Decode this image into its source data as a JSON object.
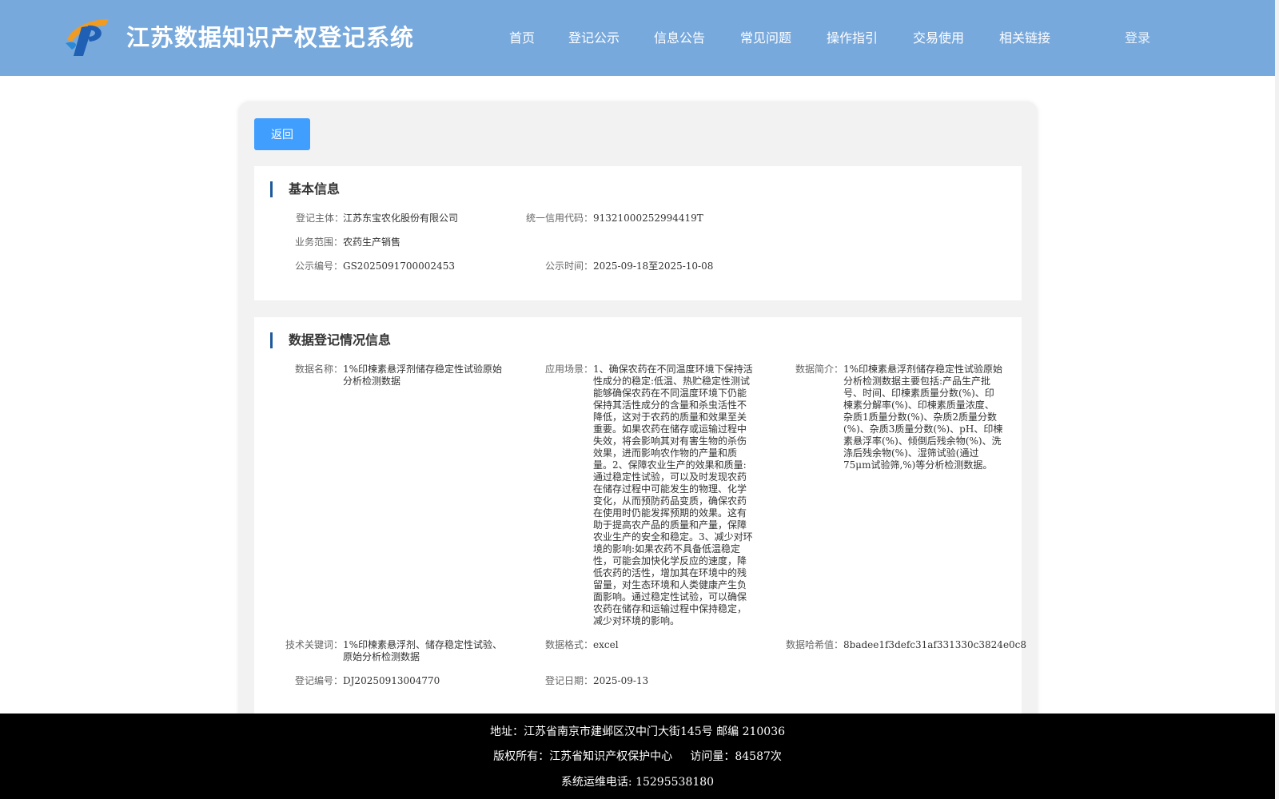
{
  "header": {
    "title": "江苏数据知识产权登记系统",
    "nav": [
      "首页",
      "登记公示",
      "信息公告",
      "常见问题",
      "操作指引",
      "交易使用",
      "相关链接"
    ],
    "login": "登录"
  },
  "back_label": "返回",
  "basic": {
    "title": "基本信息",
    "subject_label": "登记主体：",
    "subject_value": "江苏东宝农化股份有限公司",
    "credit_label": "统一信用代码：",
    "credit_value": "91321000252994419T",
    "scope_label": "业务范围：",
    "scope_value": "农药生产销售",
    "pub_no_label": "公示编号：",
    "pub_no_value": "GS2025091700002453",
    "pub_time_label": "公示时间：",
    "pub_time_value": "2025-09-18至2025-10-08"
  },
  "registration": {
    "title": "数据登记情况信息",
    "name_label": "数据名称：",
    "name_value": "1%印楝素悬浮剂储存稳定性试验原始分析检测数据",
    "scene_label": "应用场景：",
    "scene_value": "1、确保农药在不同温度环境下保持活性成分的稳定:低温、热贮稳定性测试能够确保农药在不同温度环境下仍能保持其活性成分的含量和杀虫活性不降低，这对于农药的质量和效果至关重要。如果农药在储存或运输过程中失效，将会影响其对有害生物的杀伤效果，进而影响农作物的产量和质量。2、保障农业生产的效果和质量:通过稳定性试验，可以及时发现农药在储存过程中可能发生的物理、化学变化，从而预防药品变质，确保农药在使用时仍能发挥预期的效果。这有助于提高农产品的质量和产量，保障农业生产的安全和稳定。3、减少对环境的影响:如果农药不具备低温稳定性，可能会加快化学反应的速度，降低农药的活性，增加其在环境中的残留量，对生态环境和人类健康产生负面影响。通过稳定性试验，可以确保农药在储存和运输过程中保持稳定，减少对环境的影响。",
    "summary_label": "数据简介：",
    "summary_value": "1%印楝素悬浮剂储存稳定性试验原始分析检测数据主要包括:产品生产批号、时间、印楝素质量分数(%)、印楝素分解率(%)、印楝素质量浓度、杂质1质量分数(%)、杂质2质量分数(%)、杂质3质量分数(%)、pH、印楝素悬浮率(%)、倾倒后残余物(%)、洗涤后残余物(%)、湿筛试验(通过75μm试验筛,%)等分析检测数据。",
    "keywords_label": "技术关键词：",
    "keywords_value": "1%印楝素悬浮剂、储存稳定性试验、原始分析检测数据",
    "format_label": "数据格式：",
    "format_value": "excel",
    "hash_label": "数据哈希值：",
    "hash_value": "8badee1f3defc31af331330c3824e0c8",
    "reg_no_label": "登记编号：",
    "reg_no_value": "DJ20250913004770",
    "reg_date_label": "登记日期：",
    "reg_date_value": "2025-09-13"
  },
  "footer": {
    "address": "地址：江苏省南京市建邺区汉中门大街145号 邮编 210036",
    "copyright": "版权所有：江苏省知识产权保护中心     访问量：84587次",
    "phone": "系统运维电话: 15295538180"
  },
  "colors": {
    "header_bg": "#78a9dd",
    "button_bg": "#409eff",
    "accent_bar": "#1e5a9a",
    "footer_bg": "#000000"
  }
}
